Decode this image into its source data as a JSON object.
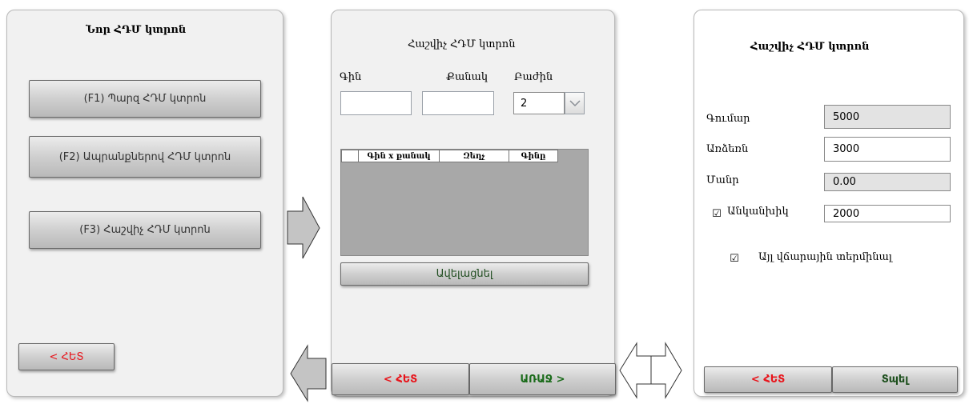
{
  "panel1": {
    "title": "Նոր ՀԴՄ կտրոն",
    "buttons": [
      "(F1) Պարզ ՀԴՄ կտրոն",
      "(F2) Ապրանքներով ՀԴՄ կտրոն",
      "(F3)  Հաշվիչ ՀԴՄ կտրոն"
    ],
    "back_label": "< ՀԵՏ"
  },
  "panel2": {
    "title": "Հաշվիչ ՀԴՄ կտրոն",
    "labels": {
      "price": "Գին",
      "quantity": "Քանակ",
      "department": "Բաժին"
    },
    "price_value": "",
    "quantity_value": "",
    "department_value": "2",
    "table_headers": [
      "",
      "Գին x քանակ",
      "Զեղչ",
      "Գինը"
    ],
    "add_label": "Ավելացնել",
    "back_label": "< ՀԵՏ",
    "next_label": "ԱՌԱՋ >"
  },
  "panel3": {
    "title": "Հաշվիչ ՀԴՄ կտրոն",
    "amount_label": "Գումար",
    "amount_value": "5000",
    "paid_label": "Առձեռն",
    "paid_value": "3000",
    "change_label": "Մանր",
    "change_value": "0.00",
    "cashless_label": "Անկանխիկ",
    "cashless_value": "2000",
    "cashless_checked": "☑",
    "terminal_label": "Այլ վճարային տերմինալ",
    "terminal_checked": "☑",
    "back_label": "< ՀԵՏ",
    "print_label": "Տպել"
  },
  "colors": {
    "panel_bg": "#f1f1f1",
    "grid_bg": "#a8a8a8",
    "back_red": "#e8131a",
    "ok_green": "#1a6b1a"
  }
}
